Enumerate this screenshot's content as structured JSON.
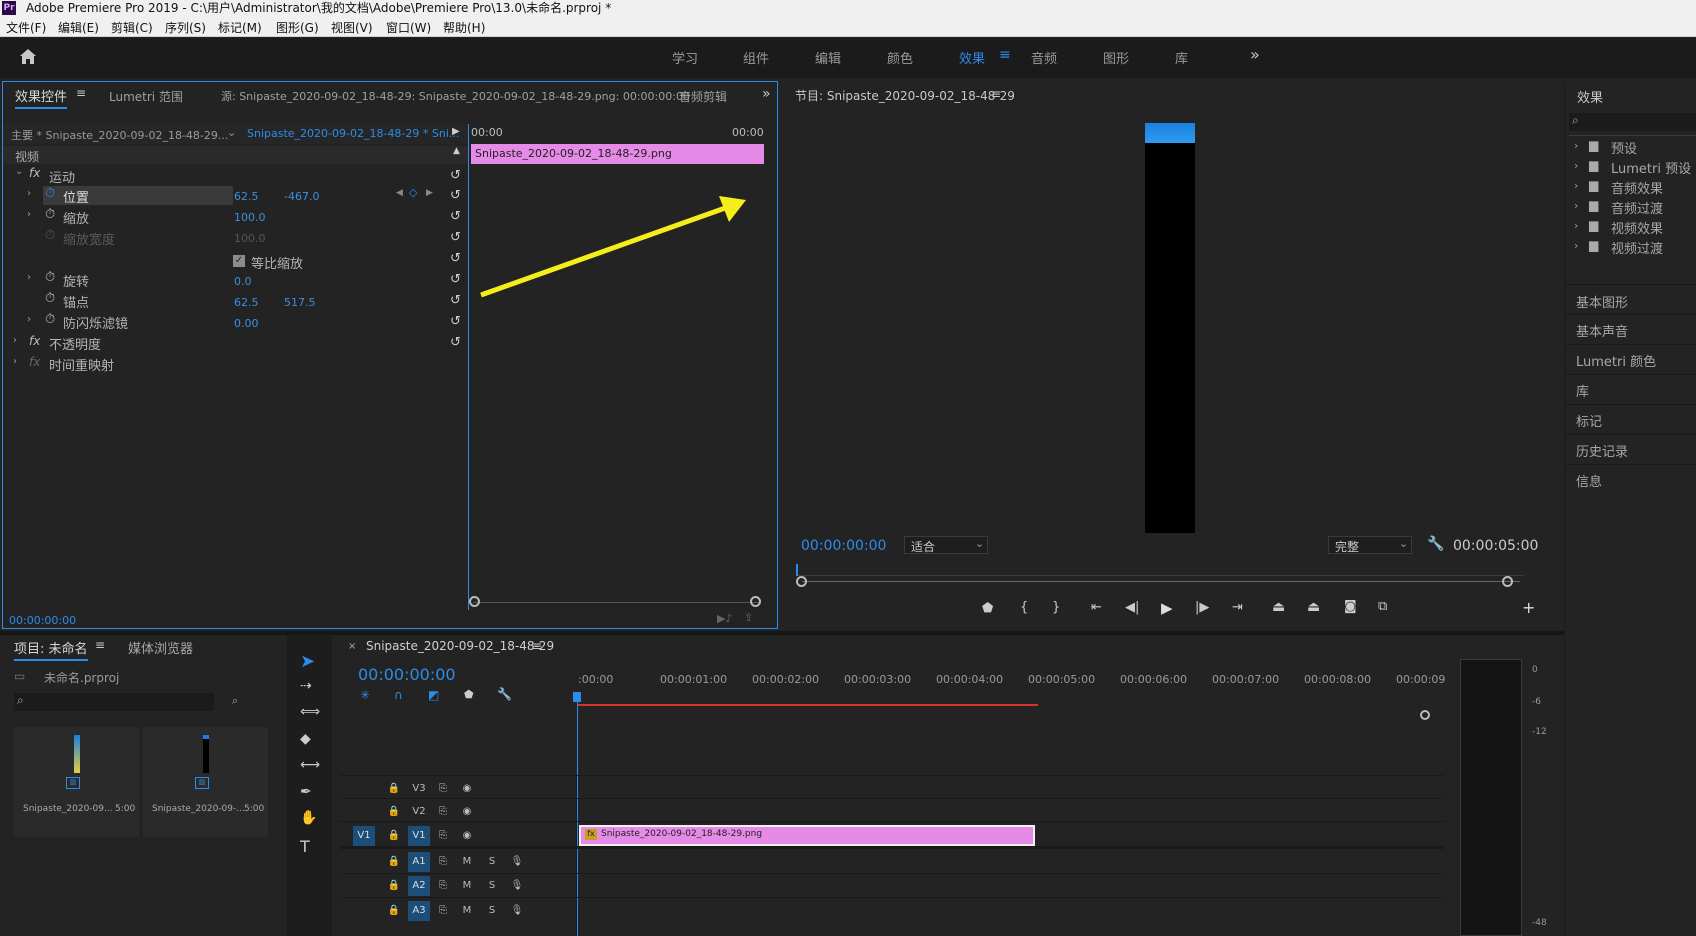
{
  "titlebar": {
    "text": "Adobe Premiere Pro 2019 - C:\\用户\\Administrator\\我的文档\\Adobe\\Premiere Pro\\13.0\\未命名.prproj *",
    "logo": "Pr"
  },
  "menu": [
    "文件(F)",
    "编辑(E)",
    "剪辑(C)",
    "序列(S)",
    "标记(M)",
    "图形(G)",
    "视图(V)",
    "窗口(W)",
    "帮助(H)"
  ],
  "workspaces": [
    "学习",
    "组件",
    "编辑",
    "颜色",
    "效果",
    "音频",
    "图形",
    "库"
  ],
  "workspace_active": "效果",
  "effect_controls": {
    "tabs": [
      "效果控件",
      "Lumetri 范围",
      "源: Snipaste_2020-09-02_18-48-29: Snipaste_2020-09-02_18-48-29.png: 00:00:00:00",
      "音频剪辑"
    ],
    "master": "主要 * Snipaste_2020-09-02_18-48-29...",
    "sequence": "Snipaste_2020-09-02_18-48-29 * Sni...",
    "section": "视频",
    "motion": "运动",
    "fx_label": "fx",
    "position": {
      "label": "位置",
      "x": "62.5",
      "y": "-467.0"
    },
    "scale": {
      "label": "缩放",
      "value": "100.0"
    },
    "scale_width": {
      "label": "缩放宽度",
      "value": "100.0"
    },
    "uniform": "等比缩放",
    "rotation": {
      "label": "旋转",
      "value": "0.0"
    },
    "anchor": {
      "label": "锚点",
      "x": "62.5",
      "y": "517.5"
    },
    "flicker": {
      "label": "防闪烁滤镜",
      "value": "0.00"
    },
    "opacity": "不透明度",
    "time_remap": "时间重映射",
    "tl_start": "00:00",
    "tl_end": "00:00",
    "clip_name": "Snipaste_2020-09-02_18-48-29.png",
    "timecode": "00:00:00:00"
  },
  "program": {
    "title": "节目: Snipaste_2020-09-02_18-48-29",
    "timecode": "00:00:00:00",
    "fit": "适合",
    "quality": "完整",
    "duration": "00:00:05:00"
  },
  "effects_panel": {
    "title": "效果",
    "items": [
      "预设",
      "Lumetri 预设",
      "音频效果",
      "音频过渡",
      "视频效果",
      "视频过渡"
    ],
    "panels": [
      "基本图形",
      "基本声音",
      "Lumetri 颜色",
      "库",
      "标记",
      "历史记录",
      "信息"
    ]
  },
  "project": {
    "tabs": [
      "项目: 未命名",
      "媒体浏览器"
    ],
    "file": "未命名.prproj",
    "items": [
      {
        "name": "Snipaste_2020-09...",
        "dur": "5:00"
      },
      {
        "name": "Snipaste_2020-09-...",
        "dur": "5:00"
      }
    ]
  },
  "timeline": {
    "title": "Snipaste_2020-09-02_18-48-29",
    "timecode": "00:00:00:00",
    "ticks": [
      ":00:00",
      "00:00:01:00",
      "00:00:02:00",
      "00:00:03:00",
      "00:00:04:00",
      "00:00:05:00",
      "00:00:06:00",
      "00:00:07:00",
      "00:00:08:00",
      "00:00:09:"
    ],
    "video_tracks": [
      "V3",
      "V2",
      "V1"
    ],
    "audio_tracks": [
      "A1",
      "A2",
      "A3"
    ],
    "src_v": "V1",
    "clip": "Snipaste_2020-09-02_18-48-29.png",
    "ms": [
      "M",
      "S"
    ]
  },
  "meter": {
    "labels": [
      "0",
      "-6",
      "-12",
      "-48"
    ]
  },
  "colors": {
    "accent": "#2d8ceb",
    "clip": "#e58ae6",
    "arrow": "#f5ee1a",
    "playhead_red": "#d9322a"
  }
}
